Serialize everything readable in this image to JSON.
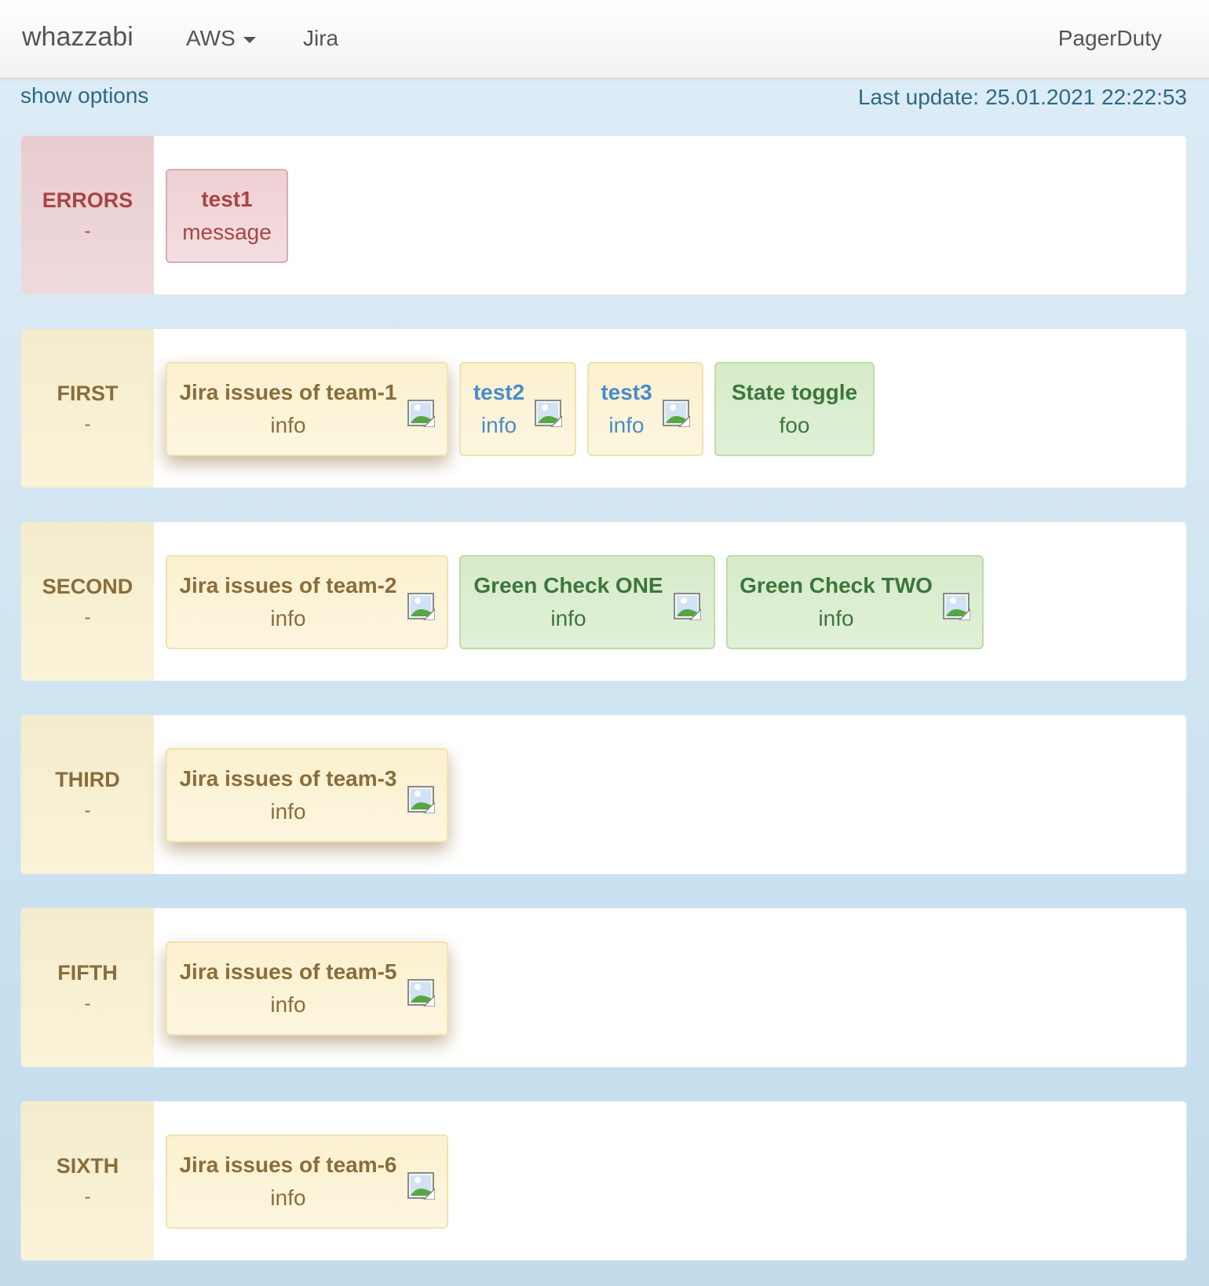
{
  "navbar": {
    "brand": "whazzabi",
    "items": [
      {
        "label": "AWS",
        "dropdown": true
      },
      {
        "label": "Jira"
      }
    ],
    "right_item": "PagerDuty"
  },
  "toolbar": {
    "show_options": "show options",
    "last_update_label": "Last update:",
    "last_update_value": "25.01.2021 22:22:53"
  },
  "colors": {
    "background": "#d2e5f1",
    "error_text": "#a94442",
    "warning_text": "#8a6d3b",
    "success_text": "#3c763d",
    "info_blue": "#4a8cc9",
    "link": "#2d6987"
  },
  "groups": [
    {
      "name": "ERRORS",
      "status": "-",
      "tiles": [
        {
          "title": "test1",
          "subtitle": "message",
          "type": "error",
          "icon": "broken-image-icon"
        }
      ]
    },
    {
      "name": "FIRST",
      "status": "-",
      "tiles": [
        {
          "title": "Jira issues of team-1",
          "subtitle": "info",
          "type": "warning",
          "icon": "broken-image-icon"
        },
        {
          "title": "test2",
          "subtitle": "info",
          "type": "warning-link",
          "icon": "broken-image-icon"
        },
        {
          "title": "test3",
          "subtitle": "info",
          "type": "warning-link",
          "icon": "broken-image-icon"
        },
        {
          "title": "State toggle",
          "subtitle": "foo",
          "type": "success"
        }
      ]
    },
    {
      "name": "SECOND",
      "status": "-",
      "tiles": [
        {
          "title": "Jira issues of team-2",
          "subtitle": "info",
          "type": "warning",
          "icon": "broken-image-icon"
        },
        {
          "title": "Green Check ONE",
          "subtitle": "info",
          "type": "success",
          "icon": "broken-image-icon"
        },
        {
          "title": "Green Check TWO",
          "subtitle": "info",
          "type": "success",
          "icon": "broken-image-icon"
        }
      ]
    },
    {
      "name": "THIRD",
      "status": "-",
      "tiles": [
        {
          "title": "Jira issues of team-3",
          "subtitle": "info",
          "type": "warning",
          "icon": "broken-image-icon"
        }
      ]
    },
    {
      "name": "FIFTH",
      "status": "-",
      "tiles": [
        {
          "title": "Jira issues of team-5",
          "subtitle": "info",
          "type": "warning",
          "icon": "broken-image-icon"
        }
      ]
    },
    {
      "name": "SIXTH",
      "status": "-",
      "tiles": [
        {
          "title": "Jira issues of team-6",
          "subtitle": "info",
          "type": "warning",
          "icon": "broken-image-icon"
        }
      ]
    }
  ]
}
